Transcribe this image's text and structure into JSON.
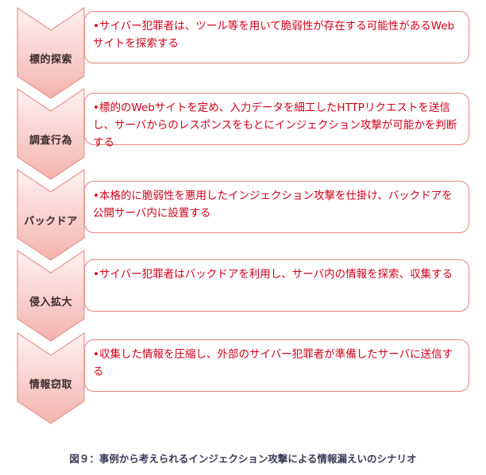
{
  "diagram": {
    "steps": [
      {
        "label": "標的探索",
        "bullet": "•",
        "description": "サイバー犯罪者は、ツール等を用いて脆弱性が存在する可能性があるWebサイトを探索する"
      },
      {
        "label": "調査行為",
        "bullet": "•",
        "description": "標的のWebサイトを定め、入力データを細工したHTTPリクエストを送信し、サーバからのレスポンスをもとにインジェクション攻撃が可能かを判断する"
      },
      {
        "label": "バックドア",
        "bullet": "•",
        "description": "本格的に脆弱性を悪用したインジェクション攻撃を仕掛け、バックドアを公開サーバ内に設置する"
      },
      {
        "label": "侵入拡大",
        "bullet": "•",
        "description": "サイバー犯罪者はバックドアを利用し、サーバ内の情報を探索、収集する"
      },
      {
        "label": "情報窃取",
        "bullet": "•",
        "description": "収集した情報を圧縮し、外部のサイバー犯罪者が準備したサーバに送信する"
      }
    ],
    "caption": "図９：事例から考えられるインジェクション攻撃による情報漏えいのシナリオ",
    "colors": {
      "chevron_top": "#fdf0ef",
      "chevron_bottom": "#f4b6b0",
      "chevron_stroke": "#e8968f",
      "box_border": "#e2877f",
      "text_red": "#d0021b"
    }
  }
}
